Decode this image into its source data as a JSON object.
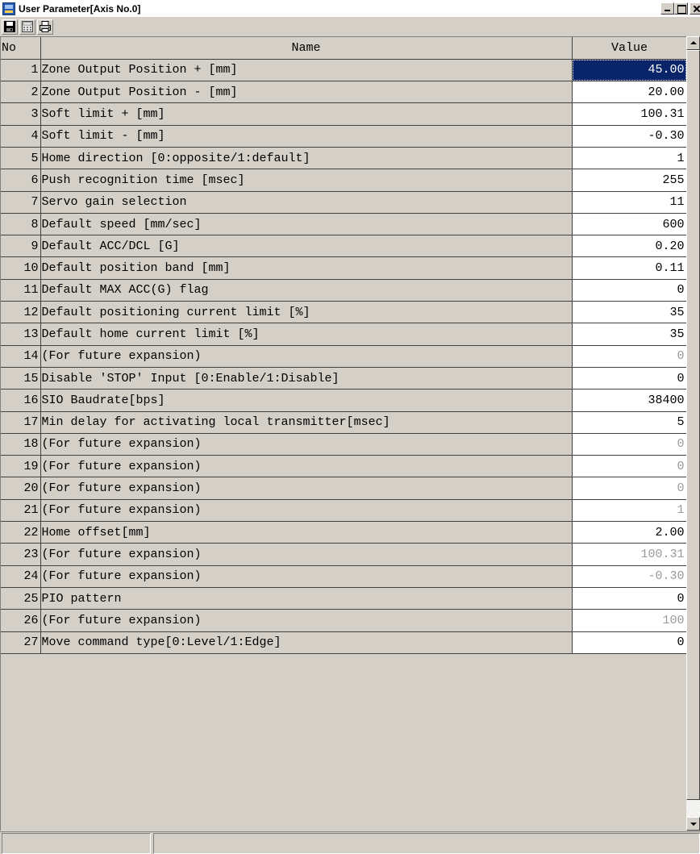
{
  "window": {
    "title": "User Parameter[Axis No.0]"
  },
  "toolbar": {
    "buttons": [
      "save-icon",
      "calculator-icon",
      "print-icon"
    ]
  },
  "table": {
    "headers": {
      "no": "No",
      "name": "Name",
      "value": "Value"
    },
    "rows": [
      {
        "no": "1",
        "name": "Zone Output Position + [mm]",
        "value": "45.00",
        "state": "selected"
      },
      {
        "no": "2",
        "name": "Zone Output Position - [mm]",
        "value": "20.00",
        "state": "normal"
      },
      {
        "no": "3",
        "name": "Soft limit + [mm]",
        "value": "100.31",
        "state": "normal"
      },
      {
        "no": "4",
        "name": "Soft limit - [mm]",
        "value": "-0.30",
        "state": "normal"
      },
      {
        "no": "5",
        "name": "Home direction [0:opposite/1:default]",
        "value": "1",
        "state": "normal"
      },
      {
        "no": "6",
        "name": "Push recognition time [msec]",
        "value": "255",
        "state": "normal"
      },
      {
        "no": "7",
        "name": "Servo gain selection",
        "value": "11",
        "state": "normal"
      },
      {
        "no": "8",
        "name": "Default speed [mm/sec]",
        "value": "600",
        "state": "normal"
      },
      {
        "no": "9",
        "name": "Default ACC/DCL [G]",
        "value": "0.20",
        "state": "normal"
      },
      {
        "no": "10",
        "name": "Default position band [mm]",
        "value": "0.11",
        "state": "normal"
      },
      {
        "no": "11",
        "name": "Default MAX ACC(G) flag",
        "value": "0",
        "state": "normal"
      },
      {
        "no": "12",
        "name": "Default positioning current limit [%]",
        "value": "35",
        "state": "normal"
      },
      {
        "no": "13",
        "name": "Default home current limit [%]",
        "value": "35",
        "state": "normal"
      },
      {
        "no": "14",
        "name": "(For future expansion)",
        "value": "0",
        "state": "dim"
      },
      {
        "no": "15",
        "name": "Disable 'STOP' Input [0:Enable/1:Disable]",
        "value": "0",
        "state": "normal"
      },
      {
        "no": "16",
        "name": "SIO Baudrate[bps]",
        "value": "38400",
        "state": "normal"
      },
      {
        "no": "17",
        "name": "Min delay for activating local transmitter[msec]",
        "value": "5",
        "state": "normal"
      },
      {
        "no": "18",
        "name": "(For future expansion)",
        "value": "0",
        "state": "dim"
      },
      {
        "no": "19",
        "name": "(For future expansion)",
        "value": "0",
        "state": "dim"
      },
      {
        "no": "20",
        "name": "(For future expansion)",
        "value": "0",
        "state": "dim"
      },
      {
        "no": "21",
        "name": "(For future expansion)",
        "value": "1",
        "state": "dim"
      },
      {
        "no": "22",
        "name": "Home offset[mm]",
        "value": "2.00",
        "state": "normal"
      },
      {
        "no": "23",
        "name": "(For future expansion)",
        "value": "100.31",
        "state": "dim"
      },
      {
        "no": "24",
        "name": "(For future expansion)",
        "value": "-0.30",
        "state": "dim"
      },
      {
        "no": "25",
        "name": "PIO pattern",
        "value": "0",
        "state": "normal"
      },
      {
        "no": "26",
        "name": "(For future expansion)",
        "value": "100",
        "state": "dim"
      },
      {
        "no": "27",
        "name": "Move command type[0:Level/1:Edge]",
        "value": "0",
        "state": "normal"
      }
    ]
  },
  "colors": {
    "face": "#d4d0c8",
    "selection": "#0a246a",
    "dim_text": "#9a9a9a"
  }
}
